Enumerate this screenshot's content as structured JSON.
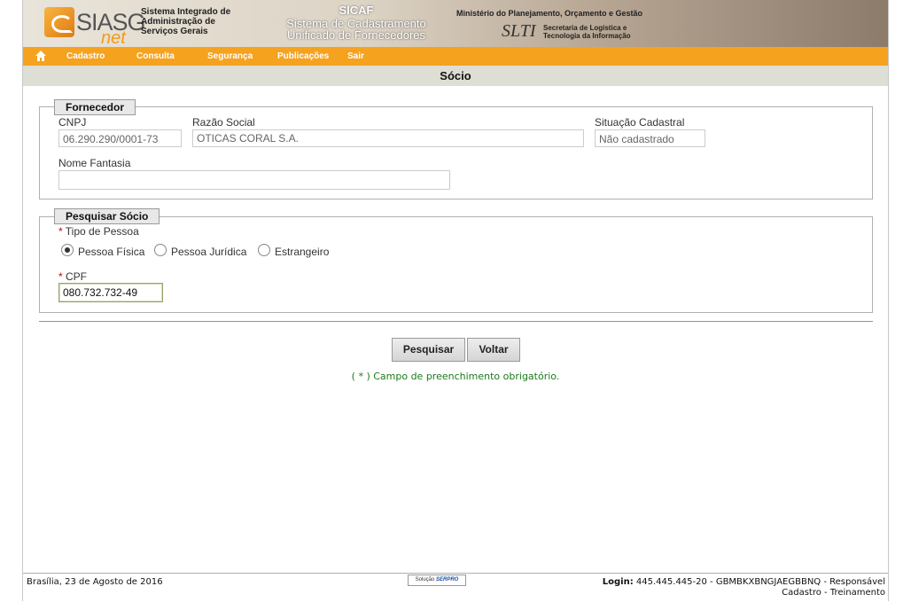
{
  "header": {
    "logo_text": "SIASG",
    "logo_sub": "net",
    "system_name_lines": [
      "Sistema Integrado de",
      "Administração de",
      "Serviços Gerais"
    ],
    "sicaf_title": "SICAF",
    "sicaf_sub_lines": [
      "Sistema de Cadastramento",
      "Unificado de Fornecedores"
    ],
    "ministry": "Ministério do Planejamento, Orçamento e Gestão",
    "slti_logo": "SLTI",
    "slti_text_lines": [
      "Secretaria de Logística e",
      "Tecnologia da Informação"
    ]
  },
  "nav": {
    "home_icon": "home-icon",
    "items": [
      "Cadastro",
      "Consulta",
      "Segurança",
      "Publicações",
      "Sair"
    ]
  },
  "page_title": "Sócio",
  "fornecedor": {
    "legend": "Fornecedor",
    "cnpj_label": "CNPJ",
    "cnpj_value": "06.290.290/0001-73",
    "razao_label": "Razão Social",
    "razao_value": "OTICAS CORAL S.A.",
    "situacao_label": "Situação Cadastral",
    "situacao_value": "Não cadastrado",
    "fantasia_label": "Nome Fantasia",
    "fantasia_value": ""
  },
  "pesquisar": {
    "legend": "Pesquisar Sócio",
    "required_mark": "*",
    "tipo_label": "Tipo de Pessoa",
    "options": [
      "Pessoa Física",
      "Pessoa Jurídica",
      "Estrangeiro"
    ],
    "selected": "Pessoa Física",
    "cpf_label": "CPF",
    "cpf_value": "080.732.732-49"
  },
  "buttons": {
    "search": "Pesquisar",
    "back": "Voltar"
  },
  "note": "( * ) Campo de preenchimento obrigatório.",
  "footer": {
    "date": "Brasília, 23 de Agosto de 2016",
    "serpro_prefix": "Solução",
    "serpro": "SERPRO",
    "login_label": "Login:",
    "login_value": "445.445.445-20 - GBMBKXBNGJAEGBBNQ - Responsável",
    "login_line2": "Cadastro - Treinamento"
  }
}
